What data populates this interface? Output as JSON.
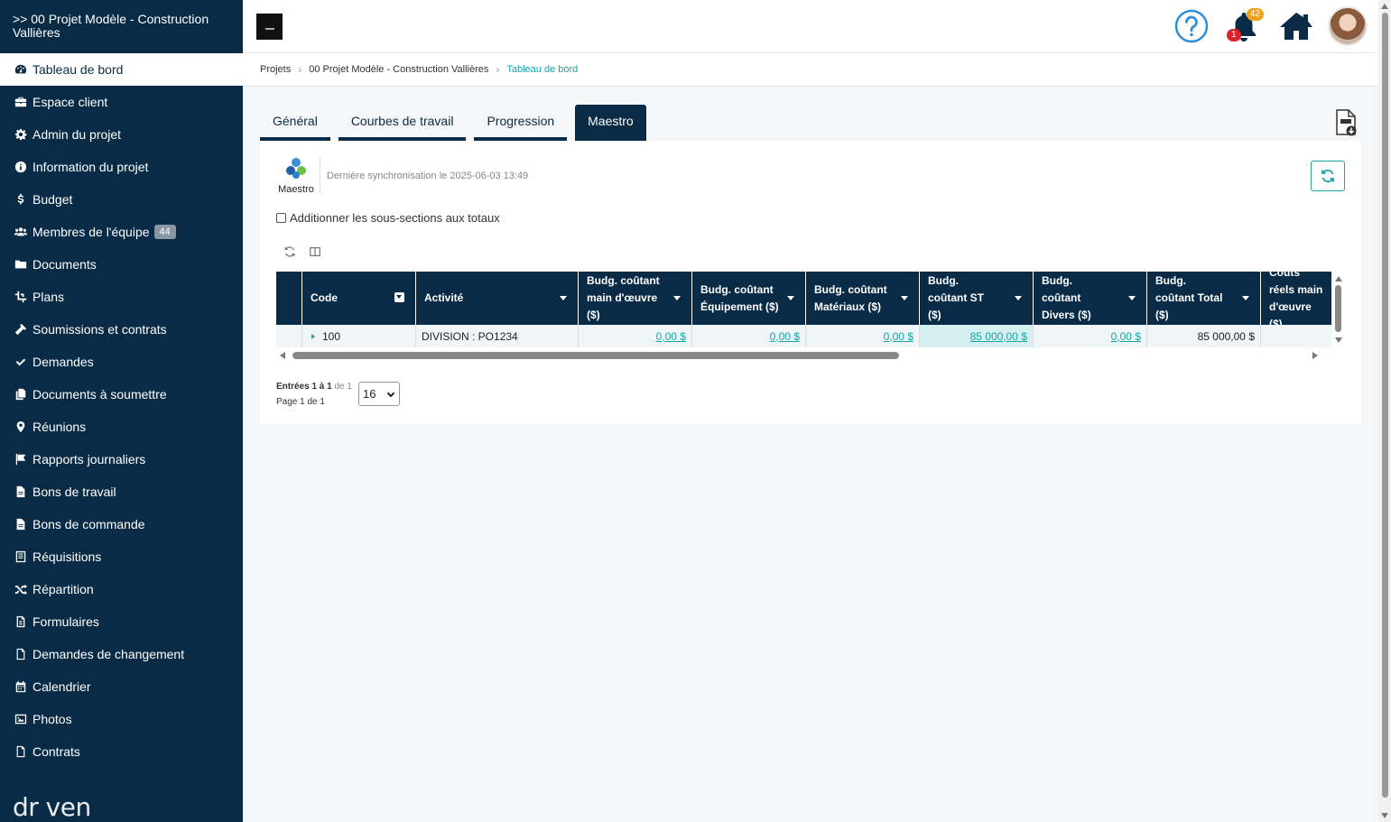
{
  "sidebar": {
    "title": ">> 00 Projet Modèle - Construction Vallières",
    "items": [
      {
        "label": "Tableau de bord",
        "icon": "dashboard-icon",
        "active": true
      },
      {
        "label": "Espace client",
        "icon": "briefcase-icon"
      },
      {
        "label": "Admin du projet",
        "icon": "gear-icon"
      },
      {
        "label": "Information du projet",
        "icon": "info-icon"
      },
      {
        "label": "Budget",
        "icon": "dollar-icon"
      },
      {
        "label": "Membres de l'équipe",
        "icon": "users-icon",
        "badge": "44"
      },
      {
        "label": "Documents",
        "icon": "folder-icon"
      },
      {
        "label": "Plans",
        "icon": "crop-icon"
      },
      {
        "label": "Soumissions et contrats",
        "icon": "hammer-icon"
      },
      {
        "label": "Demandes",
        "icon": "check-icon"
      },
      {
        "label": "Documents à soumettre",
        "icon": "copy-icon"
      },
      {
        "label": "Réunions",
        "icon": "map-pin-icon"
      },
      {
        "label": "Rapports journaliers",
        "icon": "flag-icon"
      },
      {
        "label": "Bons de travail",
        "icon": "file-icon"
      },
      {
        "label": "Bons de commande",
        "icon": "file-icon"
      },
      {
        "label": "Réquisitions",
        "icon": "list-icon"
      },
      {
        "label": "Répartition",
        "icon": "shuffle-icon"
      },
      {
        "label": "Formulaires",
        "icon": "form-icon"
      },
      {
        "label": "Demandes de changement",
        "icon": "file-outline-icon"
      },
      {
        "label": "Calendrier",
        "icon": "calendar-icon"
      },
      {
        "label": "Photos",
        "icon": "image-icon"
      },
      {
        "label": "Contrats",
        "icon": "file-outline-icon"
      }
    ],
    "logo": "dr ven"
  },
  "topbar": {
    "notifications_orange": "42",
    "notifications_red": "1"
  },
  "breadcrumb": {
    "items": [
      "Projets",
      "00 Projet Modèle - Construction Vallières"
    ],
    "current": "Tableau de bord"
  },
  "tabs": [
    "Général",
    "Courbes de travail",
    "Progression",
    "Maestro"
  ],
  "maestro": {
    "logo_label": "Maestro",
    "sync_text": "Dernière synchronisation le 2025-06-03 13:49",
    "checkbox_label": "Additionner les sous-sections aux totaux"
  },
  "table": {
    "headers": [
      "Code",
      "Activité",
      "Budg. coûtant main d'œuvre ($)",
      "Budg. coûtant Équipement ($)",
      "Budg. coûtant Matériaux ($)",
      "Budg. coûtant ST ($)",
      "Budg. coûtant Divers ($)",
      "Budg. coûtant Total ($)",
      "Coûts réels main d'œuvre ($)"
    ],
    "row": {
      "code": "100",
      "activite": "DIVISION : PO1234",
      "main_oeuvre": "0,00 $",
      "equipement": "0,00 $",
      "materiaux": "0,00 $",
      "st": "85 000,00 $",
      "divers": "0,00 $",
      "total": "85 000,00 $"
    }
  },
  "pager": {
    "entries_bold": "Entrées 1 à 1",
    "entries_muted": "de 1",
    "page": "Page 1 de 1",
    "page_size": "16"
  },
  "colors": {
    "sidebar_bg": "#0a2b45",
    "accent": "#1aa3a8"
  }
}
